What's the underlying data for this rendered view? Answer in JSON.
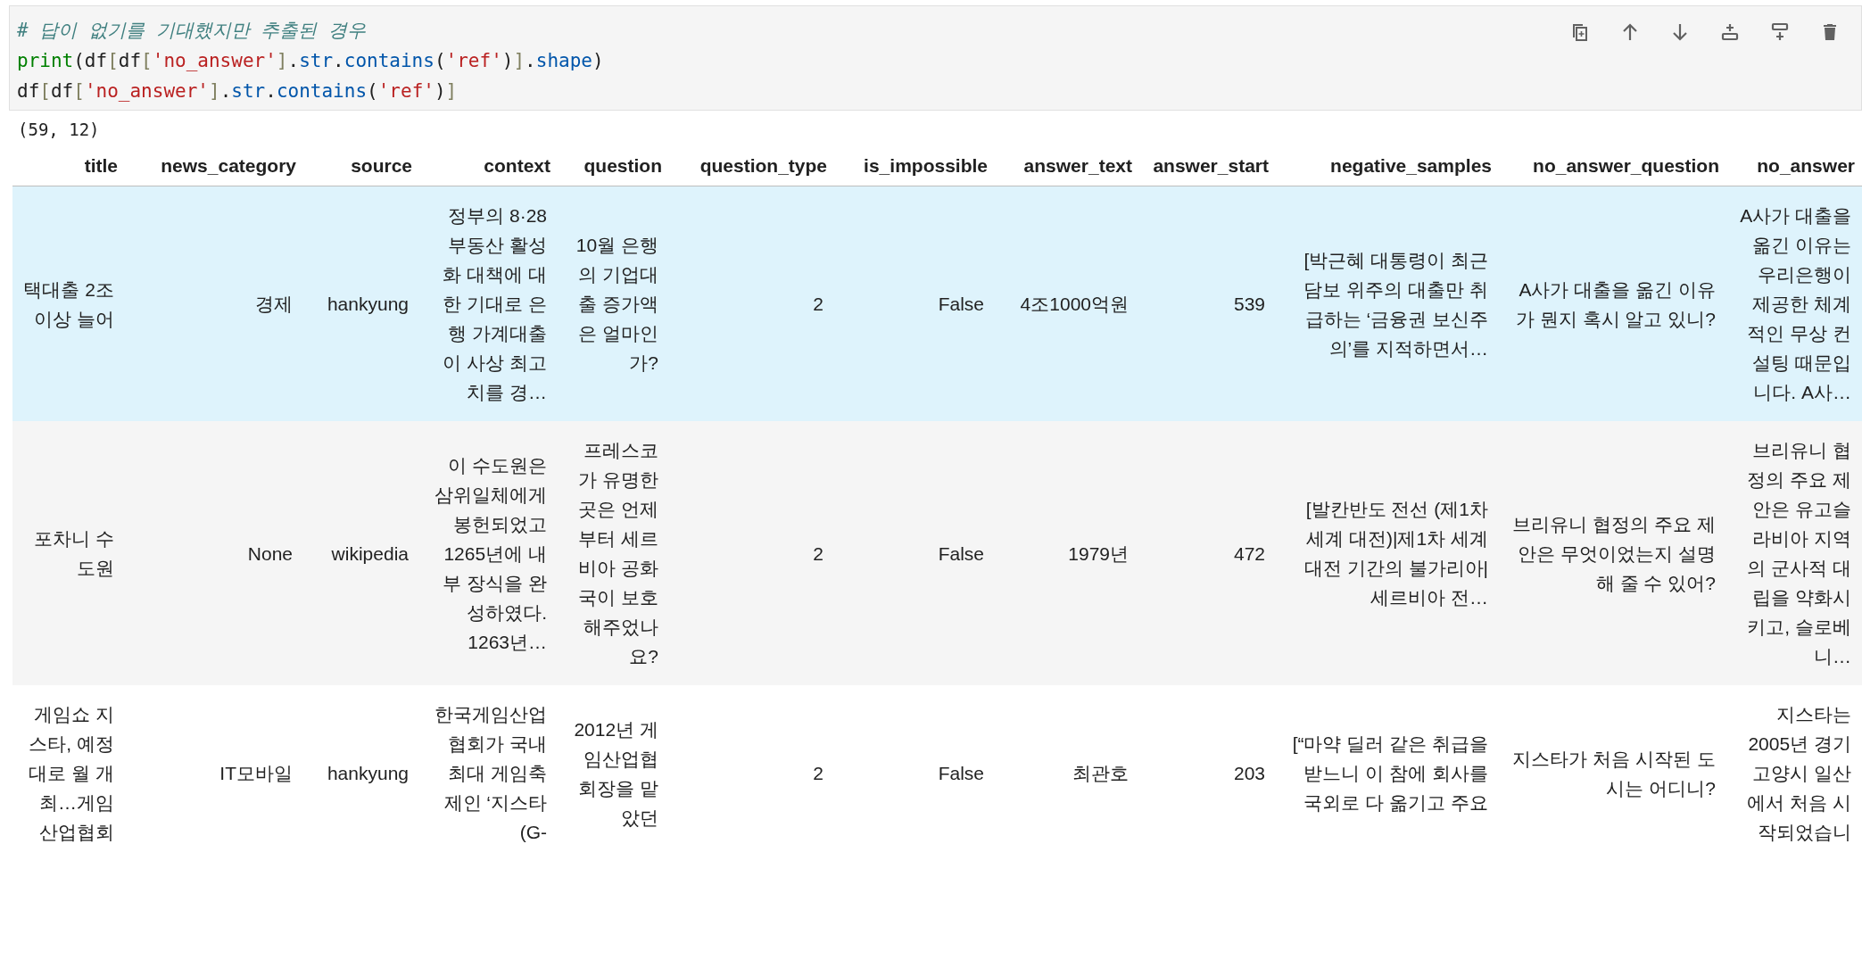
{
  "code_cell": {
    "lines": [
      [
        {
          "kind": "comment",
          "text": "# 답이 없기를 기대했지만 추출된 경우"
        }
      ],
      [
        {
          "kind": "builtin",
          "text": "print"
        },
        {
          "kind": "text",
          "text": "(df"
        },
        {
          "kind": "bracket",
          "text": "["
        },
        {
          "kind": "text",
          "text": "df"
        },
        {
          "kind": "bracket",
          "text": "["
        },
        {
          "kind": "string",
          "text": "'no_answer'"
        },
        {
          "kind": "bracket",
          "text": "]"
        },
        {
          "kind": "text",
          "text": "."
        },
        {
          "kind": "attr",
          "text": "str"
        },
        {
          "kind": "text",
          "text": "."
        },
        {
          "kind": "attr",
          "text": "contains"
        },
        {
          "kind": "text",
          "text": "("
        },
        {
          "kind": "string",
          "text": "'ref'"
        },
        {
          "kind": "text",
          "text": ")"
        },
        {
          "kind": "bracket",
          "text": "]"
        },
        {
          "kind": "text",
          "text": "."
        },
        {
          "kind": "attr",
          "text": "shape"
        },
        {
          "kind": "text",
          "text": ")"
        }
      ],
      [
        {
          "kind": "text",
          "text": "df"
        },
        {
          "kind": "bracket",
          "text": "["
        },
        {
          "kind": "text",
          "text": "df"
        },
        {
          "kind": "bracket",
          "text": "["
        },
        {
          "kind": "string",
          "text": "'no_answer'"
        },
        {
          "kind": "bracket",
          "text": "]"
        },
        {
          "kind": "text",
          "text": "."
        },
        {
          "kind": "attr",
          "text": "str"
        },
        {
          "kind": "text",
          "text": "."
        },
        {
          "kind": "attr",
          "text": "contains"
        },
        {
          "kind": "text",
          "text": "("
        },
        {
          "kind": "string",
          "text": "'ref'"
        },
        {
          "kind": "text",
          "text": ")"
        },
        {
          "kind": "bracket",
          "text": "]"
        }
      ]
    ],
    "toolbar": [
      {
        "kind": "duplicate"
      },
      {
        "kind": "move_up"
      },
      {
        "kind": "move_down"
      },
      {
        "kind": "insert_above"
      },
      {
        "kind": "insert_below"
      },
      {
        "kind": "delete"
      }
    ]
  },
  "output": {
    "text": "(59, 12)",
    "table": {
      "columns": [
        "title",
        "news_category",
        "source",
        "context",
        "question",
        "question_type",
        "is_impossible",
        "answer_text",
        "answer_start",
        "negative_samples",
        "no_answer_question",
        "no_answer"
      ],
      "rows": [
        {
          "highlighted": true,
          "cells": [
            "택대출 2조 이상 늘어",
            "경제",
            "hankyung",
            "정부의 8·28 부동산 활성화 대책에 대한 기대로 은행 가계대출이 사상 최고치를 경…",
            "10월 은행의 기업대출 증가액은 얼마인가?",
            "2",
            "False",
            "4조1000억원",
            "539",
            "[박근혜 대통령이 최근 담보 위주의 대출만 취급하는 ‘금융권 보신주의’를 지적하면서…",
            "A사가 대출을 옮긴 이유가 뭔지 혹시 알고 있니?",
            "A사가 대출을 옮긴 이유는 우리은행이 제공한 체계적인 무상 컨설팅 때문입니다. A사…"
          ]
        },
        {
          "highlighted": false,
          "cells": [
            "포차니 수도원",
            "None",
            "wikipedia",
            "이 수도원은 삼위일체에게 봉헌되었고 1265년에 내부 장식을 완성하였다. 1263년…",
            "프레스코가 유명한 곳은 언제부터 세르비아 공화국이 보호해주었나요?",
            "2",
            "False",
            "1979년",
            "472",
            "[발칸반도 전선 (제1차 세계 대전)|제1차 세계 대전 기간의 불가리아|세르비아 전…",
            "브리유니 협정의 주요 제안은 무엇이었는지 설명해 줄 수 있어?",
            "브리유니 협정의 주요 제안은 유고슬라비아 지역의 군사적 대립을 약화시키고, 슬로베니…"
          ]
        },
        {
          "highlighted": false,
          "cells": [
            "게임쇼 지스타, 예정대로 월 개최…게임산업협회",
            "IT모바일",
            "hankyung",
            "한국게임산업협회가 국내 최대 게임축제인 ‘지스타(G-",
            "2012년 게임산업협회장을 맡았던",
            "2",
            "False",
            "최관호",
            "203",
            "[“마약 딜러 같은 취급을 받느니 이 참에 회사를 국외로 다 옮기고 주요",
            "지스타가 처음 시작된 도시는 어디니?",
            "지스타는 2005년 경기 고양시 일산에서 처음 시작되었습니"
          ]
        }
      ]
    }
  }
}
